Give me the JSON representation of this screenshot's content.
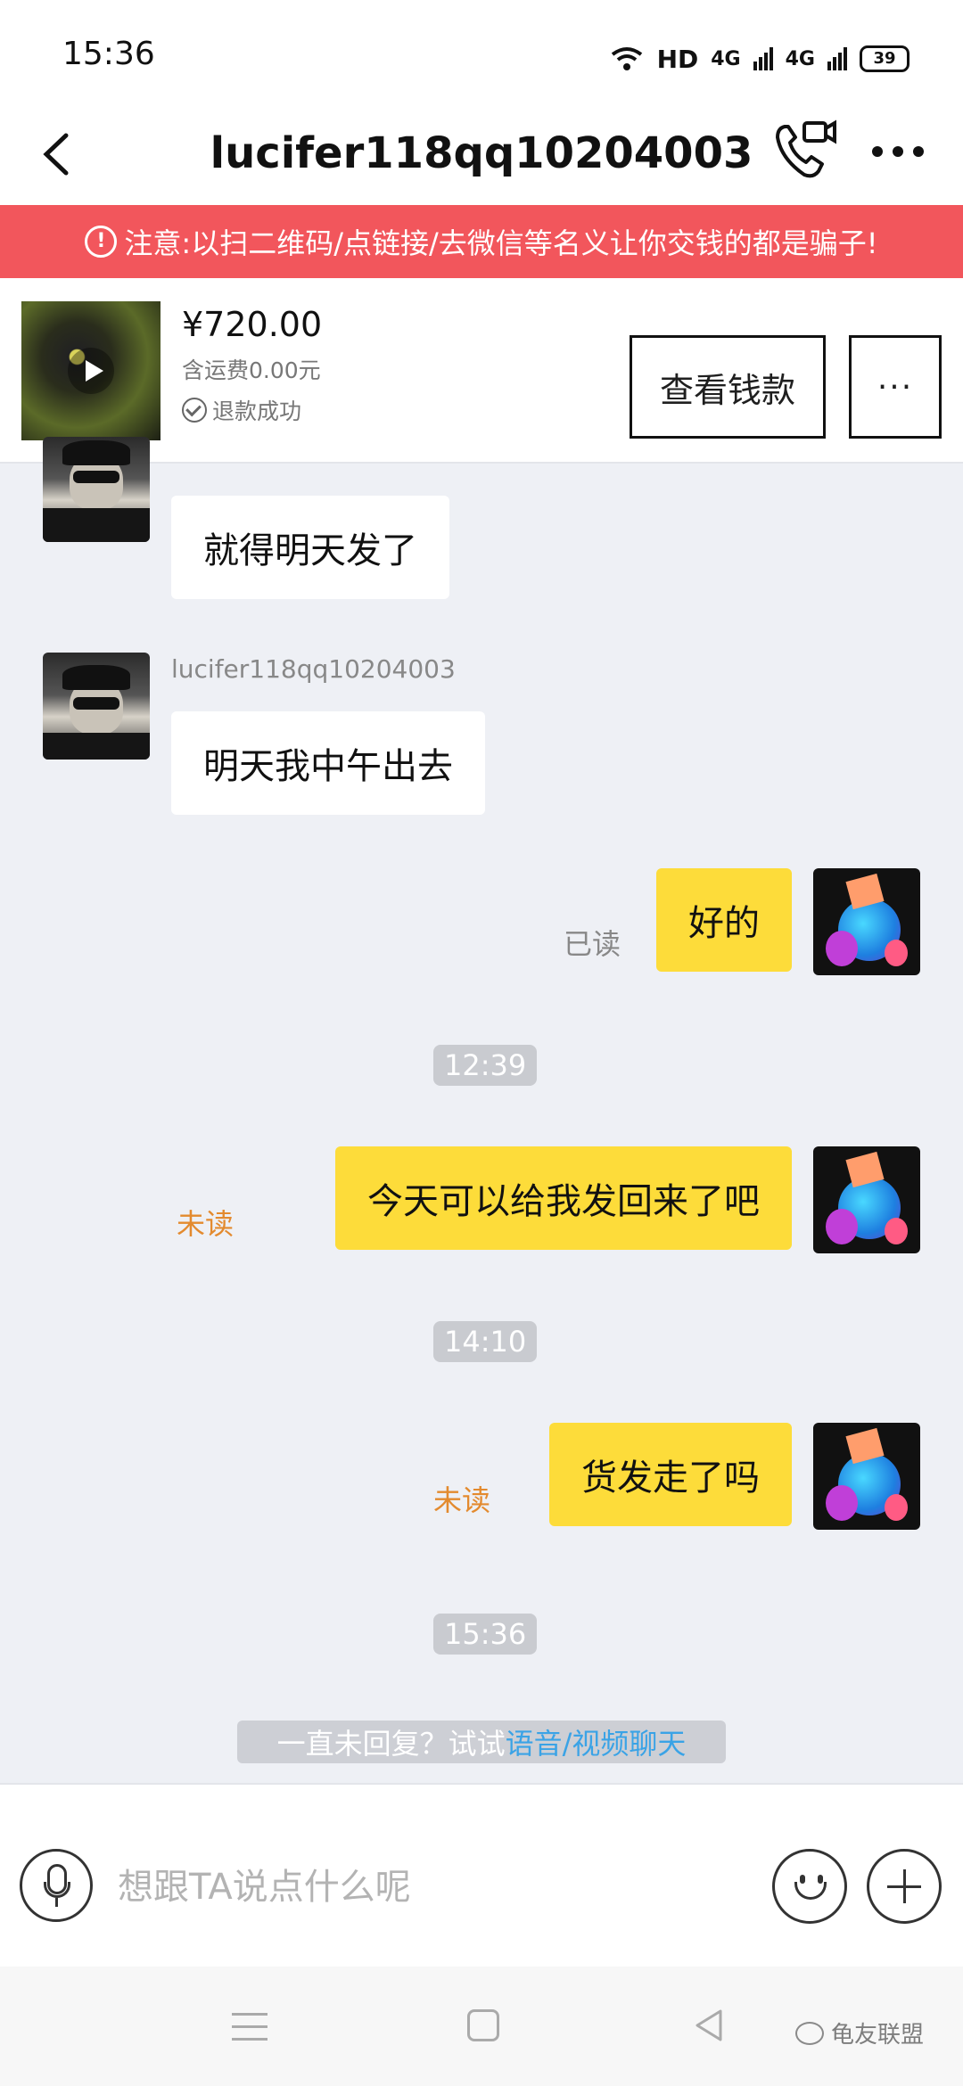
{
  "status_bar": {
    "time": "15:36",
    "network_label": "HD",
    "signal1": "4G",
    "signal2": "4G",
    "battery": "39"
  },
  "nav": {
    "title": "lucifer118qq10204003"
  },
  "warning": {
    "text": "注意:以扫二维码/点链接/去微信等名义让你交钱的都是骗子!"
  },
  "product": {
    "price": "¥720.00",
    "shipping": "含运费0.00元",
    "status": "退款成功",
    "view_button": "查看钱款",
    "more_button": "···"
  },
  "messages": [
    {
      "from": "friend",
      "text": "就得明天发了"
    },
    {
      "from": "friend",
      "sender": "lucifer118qq10204003",
      "text": "明天我中午出去"
    },
    {
      "from": "me",
      "text": "好的",
      "status": "已读"
    },
    {
      "type": "time",
      "text": "12:39"
    },
    {
      "from": "me",
      "text": "今天可以给我发回来了吧",
      "status": "未读"
    },
    {
      "type": "time",
      "text": "14:10"
    },
    {
      "from": "me",
      "text": "货发走了吗",
      "status": "未读"
    },
    {
      "type": "time",
      "text": "15:36"
    }
  ],
  "hint": {
    "prefix": "一直未回复？试试",
    "link": "语音/视频聊天"
  },
  "input": {
    "placeholder": "想跟TA说点什么呢"
  },
  "watermark": {
    "text": "龟友联盟"
  },
  "colors": {
    "warning_bg": "#f2565c",
    "my_bubble": "#fddc3a",
    "unread": "#e38a2e",
    "link": "#3aa3e6"
  }
}
